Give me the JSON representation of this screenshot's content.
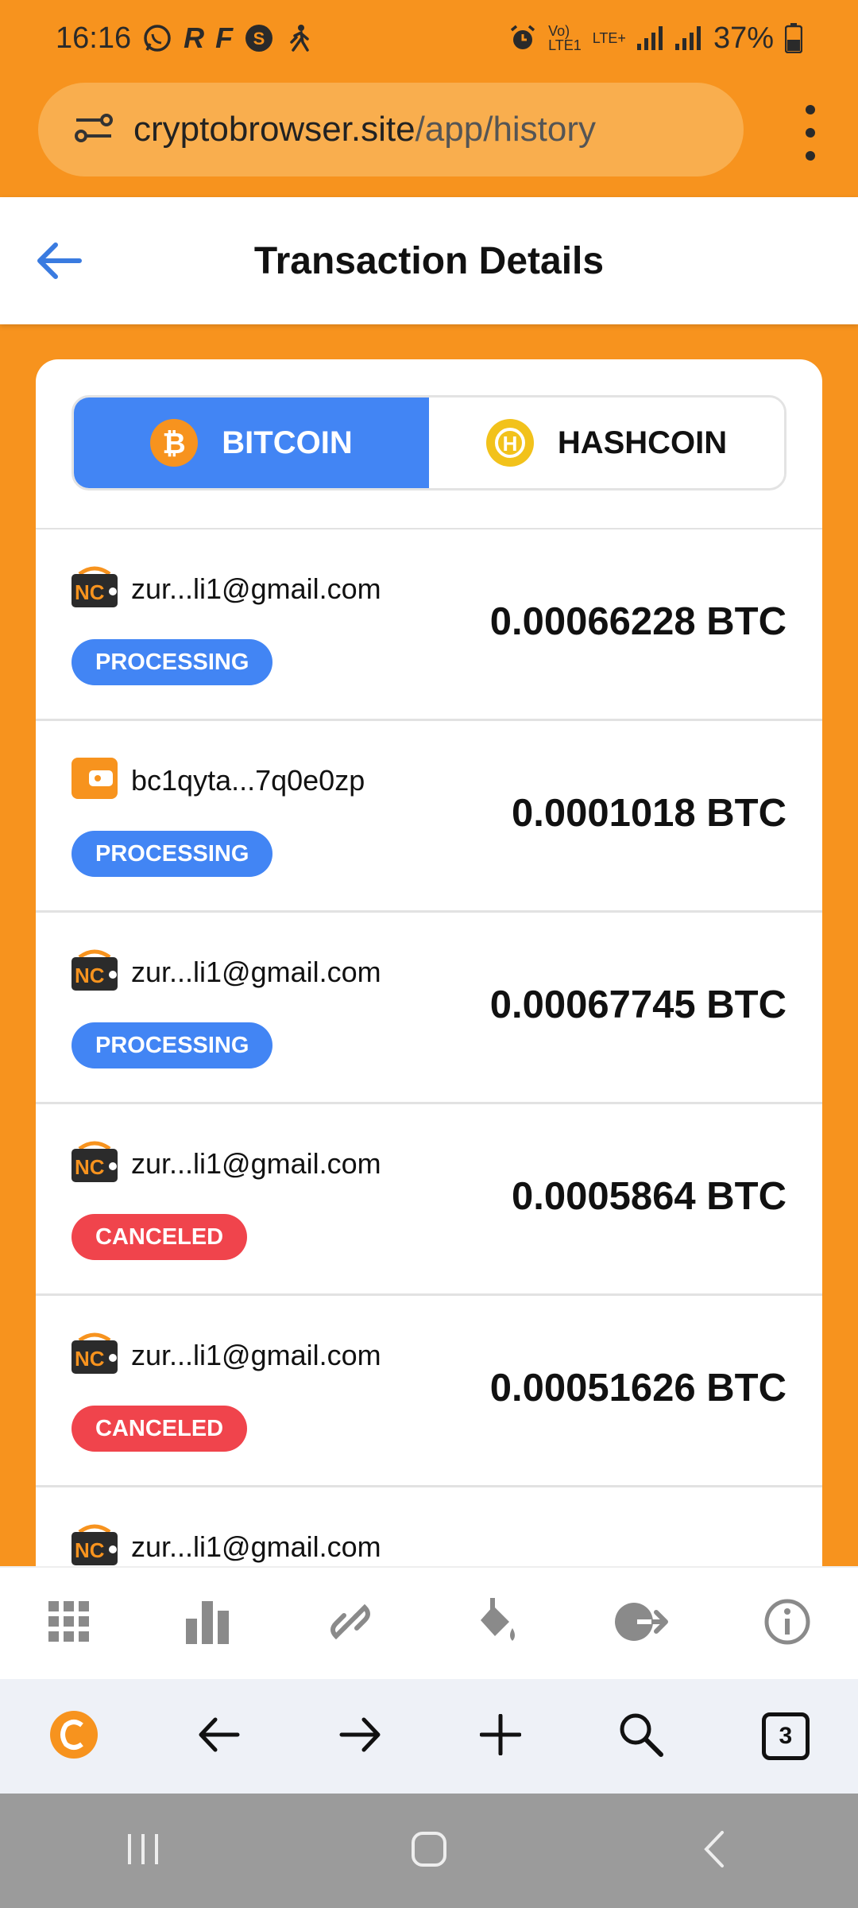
{
  "status_bar": {
    "time": "16:16",
    "network": "LTE+",
    "battery": "37%"
  },
  "browser": {
    "url_host": "cryptobrowser.site",
    "url_path": "/app/history",
    "open_tabs": "3"
  },
  "header": {
    "title": "Transaction Details"
  },
  "tabs": [
    {
      "label": "BITCOIN",
      "active": true
    },
    {
      "label": "HASHCOIN",
      "active": false
    }
  ],
  "transactions": [
    {
      "account": "zur...li1@gmail.com",
      "wallet_icon": "nc-wallet-icon",
      "status": "PROCESSING",
      "amount": "0.00066228 BTC"
    },
    {
      "account": "bc1qyta...7q0e0zp",
      "wallet_icon": "external-wallet-icon",
      "status": "PROCESSING",
      "amount": "0.0001018 BTC"
    },
    {
      "account": "zur...li1@gmail.com",
      "wallet_icon": "nc-wallet-icon",
      "status": "PROCESSING",
      "amount": "0.00067745 BTC"
    },
    {
      "account": "zur...li1@gmail.com",
      "wallet_icon": "nc-wallet-icon",
      "status": "CANCELED",
      "amount": "0.0005864 BTC"
    },
    {
      "account": "zur...li1@gmail.com",
      "wallet_icon": "nc-wallet-icon",
      "status": "CANCELED",
      "amount": "0.00051626 BTC"
    },
    {
      "account": "zur...li1@gmail.com",
      "wallet_icon": "nc-wallet-icon",
      "status": "",
      "amount": ""
    }
  ],
  "colors": {
    "brand": "#F7931E",
    "accent_blue": "#4285F4",
    "processing": "#4285F4",
    "canceled": "#F0444C"
  }
}
